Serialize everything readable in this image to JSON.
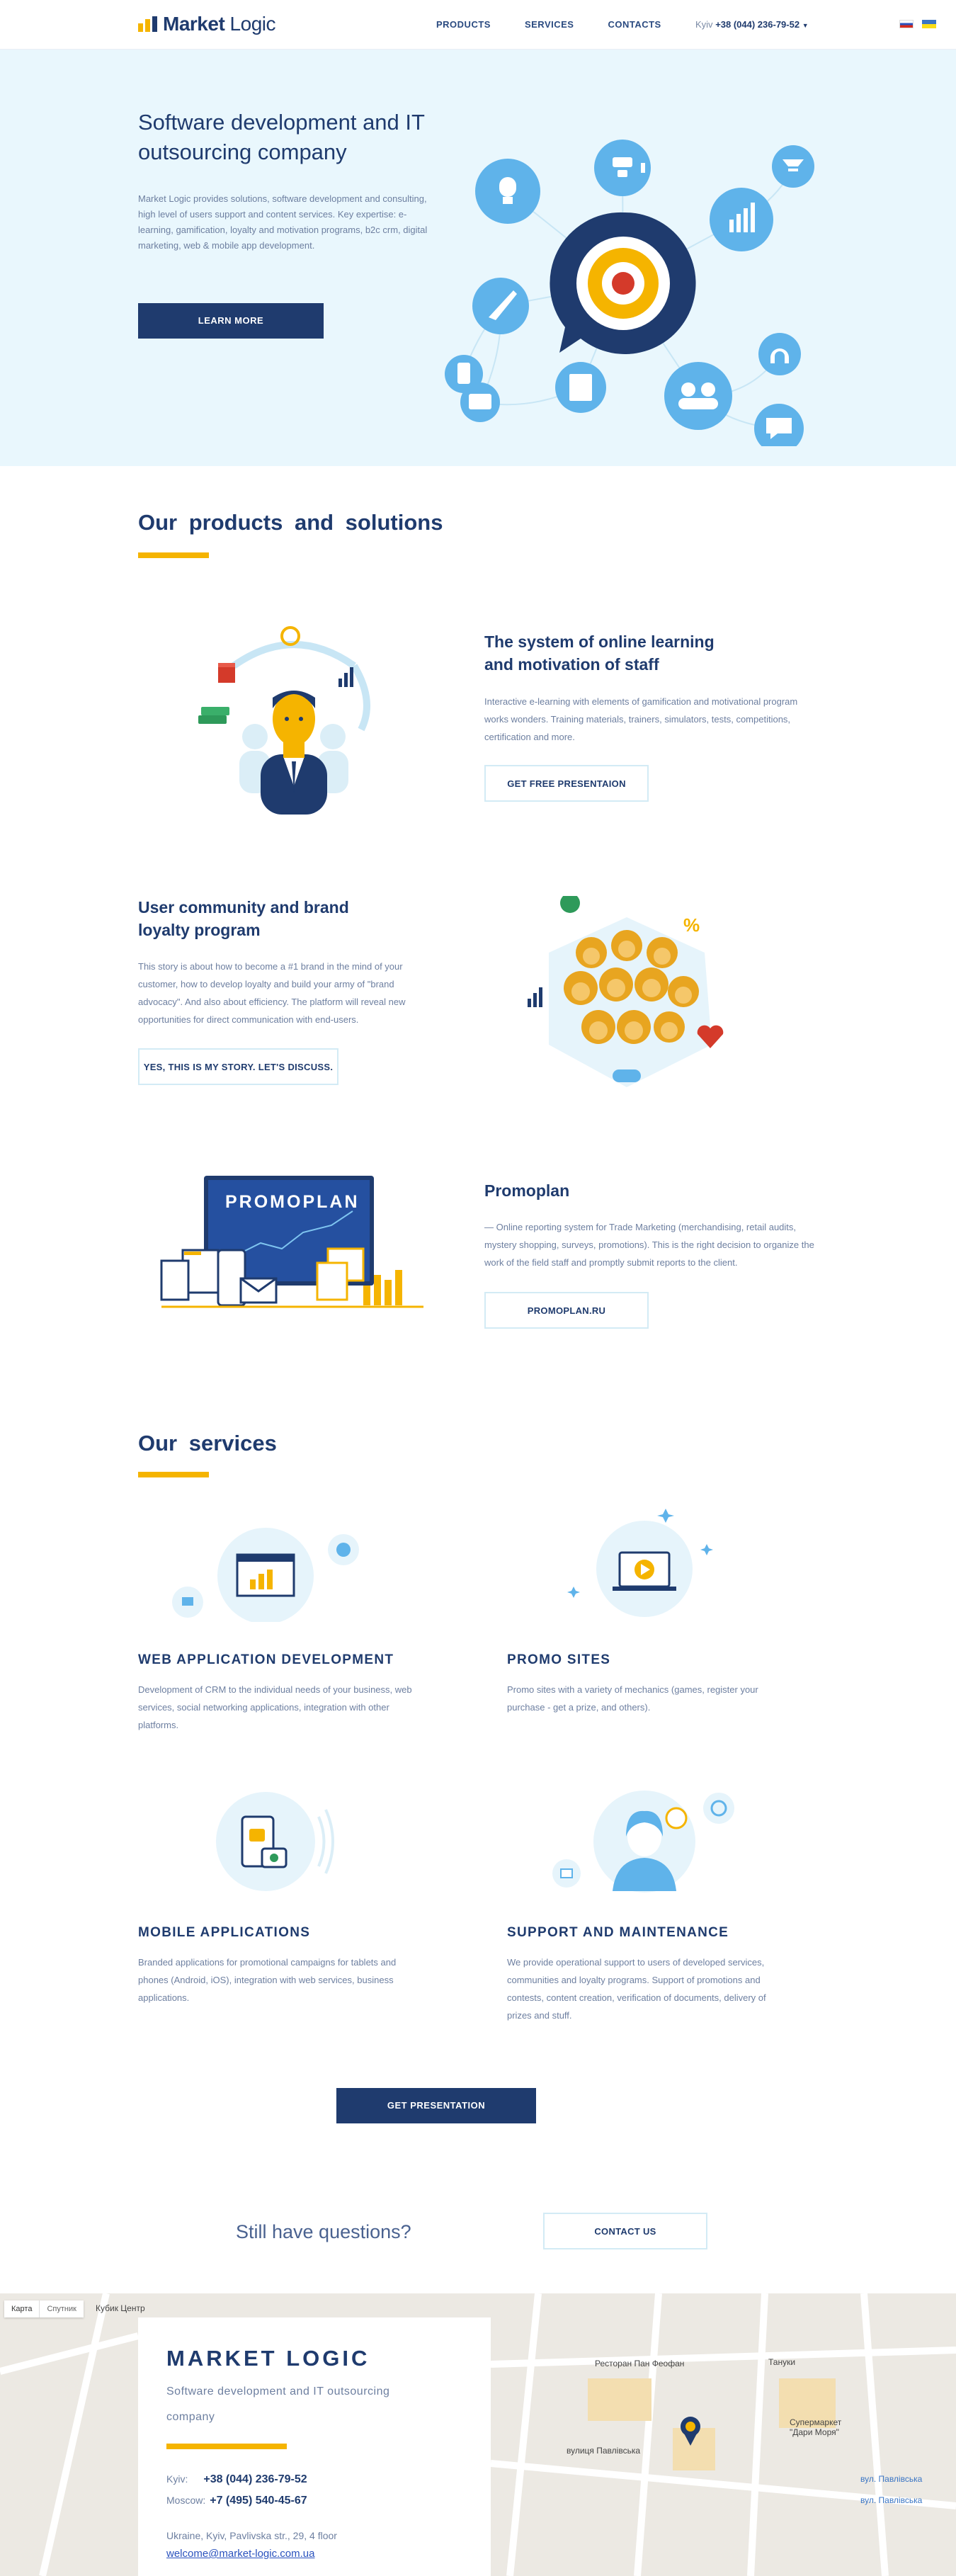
{
  "header": {
    "logo_bold": "Market",
    "logo_light": " Logic",
    "nav": [
      "PRODUCTS",
      "SERVICES",
      "CONTACTS"
    ],
    "phone_city": "Kyiv",
    "phone_number": "+38 (044) 236-79-52"
  },
  "hero": {
    "title": "Software development and IT outsourcing company",
    "text": "Market Logic provides solutions, software development and consulting, high level of users support and content services. Key expertise: e-learning, gamification, loyalty and motivation programs, b2c crm, digital marketing, web & mobile app development.",
    "button": "LEARN MORE"
  },
  "products": {
    "title": "Our products and solutions",
    "items": [
      {
        "title": "The system of online learning and motivation of staff",
        "text": "Interactive e-learning with elements of gamification and motivational program works wonders. Training materials, trainers, simulators, tests, competitions, certification and more.",
        "button": "GET FREE PRESENTAION"
      },
      {
        "title": "User community and brand loyalty program",
        "text": "This story is about how to become a #1 brand in the mind of your customer, how to develop loyalty and build your army of \"brand advocacy\". And also about efficiency. The platform will reveal new opportunities for direct communication with end-users.",
        "button": "YES, THIS IS MY STORY. LET'S DISCUSS."
      },
      {
        "title": "Promoplan",
        "text": "— Online reporting system for Trade Marketing (merchandising, retail audits, mystery shopping, surveys, promotions). This is the right decision to organize the work of the field staff and promptly submit reports to the client.",
        "button": "PROMOPLAN.RU",
        "screen_label": "PROMOPLAN"
      }
    ]
  },
  "services": {
    "title": "Our services",
    "items": [
      {
        "title": "WEB APPLICATION DEVELOPMENT",
        "text": "Development of CRM to the individual needs of your business, web services, social networking applications, integration with other platforms."
      },
      {
        "title": "PROMO SITES",
        "text": "Promo sites with a variety of mechanics (games, register your purchase - get a prize, and others)."
      },
      {
        "title": "MOBILE APPLICATIONS",
        "text": "Branded applications for promotional campaigns for tablets and phones (Android, iOS), integration with web services, business applications."
      },
      {
        "title": "SUPPORT AND MAINTENANCE",
        "text": "We provide operational support to users of developed services, communities and loyalty programs. Support of promotions and contests, content creation, verification of documents, delivery of prizes and stuff."
      }
    ],
    "button": "GET PRESENTATION"
  },
  "questions": {
    "text": "Still have questions?",
    "button": "CONTACT US"
  },
  "contacts": {
    "company": "MARKET LOGIC",
    "subtitle": "Software development and IT outsourcing company",
    "kyiv_label": "Kyiv:",
    "kyiv_phone": "+38 (044) 236-79-52",
    "moscow_label": "Moscow:",
    "moscow_phone": "+7 (495) 540-45-67",
    "address": "Ukraine, Kyiv, Pavlivska str., 29, 4 floor",
    "email": "welcome@market-logic.com.ua"
  },
  "map": {
    "tabs": [
      "Карта",
      "Спутник"
    ],
    "labels": [
      "Кубик Центр",
      "Ресторан Пан Феофан",
      "Тануки",
      "Супермаркет \"Дари Моря\"",
      "вул. Павлівська",
      "вул. Павлівська",
      "вулиця Павлівська"
    ]
  },
  "colors": {
    "navy": "#1f3b6e",
    "yellow": "#f5b400",
    "hero_bg": "#e9f7fd",
    "icon_blue": "#5fb3ea"
  }
}
